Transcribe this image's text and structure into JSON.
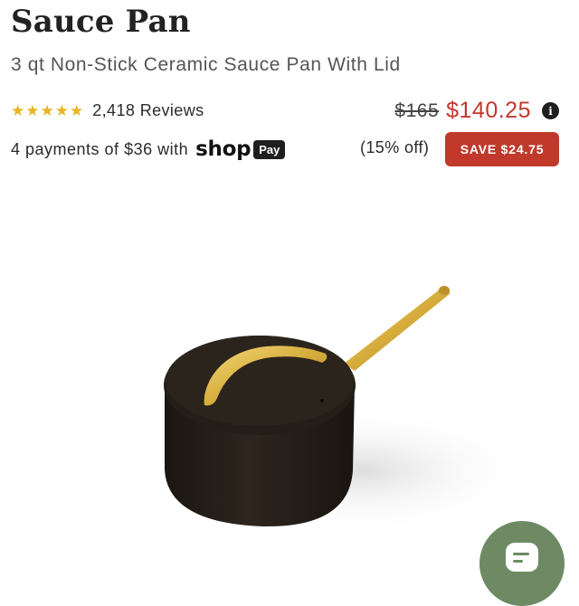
{
  "product": {
    "title": "Sauce Pan",
    "subtitle": "3 qt Non-Stick Ceramic Sauce Pan With Lid"
  },
  "rating": {
    "stars": 5,
    "review_count": "2,418 Reviews"
  },
  "price": {
    "original": "$165",
    "current": "$140.25",
    "discount_text": "(15% off)",
    "save_label": "SAVE $24.75",
    "info_glyph": "i"
  },
  "payments": {
    "text": "4 payments of $36 with",
    "shop_word": "shop",
    "pay_word": "Pay"
  },
  "colors": {
    "accent_red": "#c0392b",
    "star_gold": "#e6b522",
    "chat_green": "#6d8a64",
    "pan_body": "#2a231d",
    "handle_gold": "#d6ad3c"
  },
  "icons": {
    "star": "star-icon",
    "info": "info-icon",
    "chat": "chat-icon"
  }
}
